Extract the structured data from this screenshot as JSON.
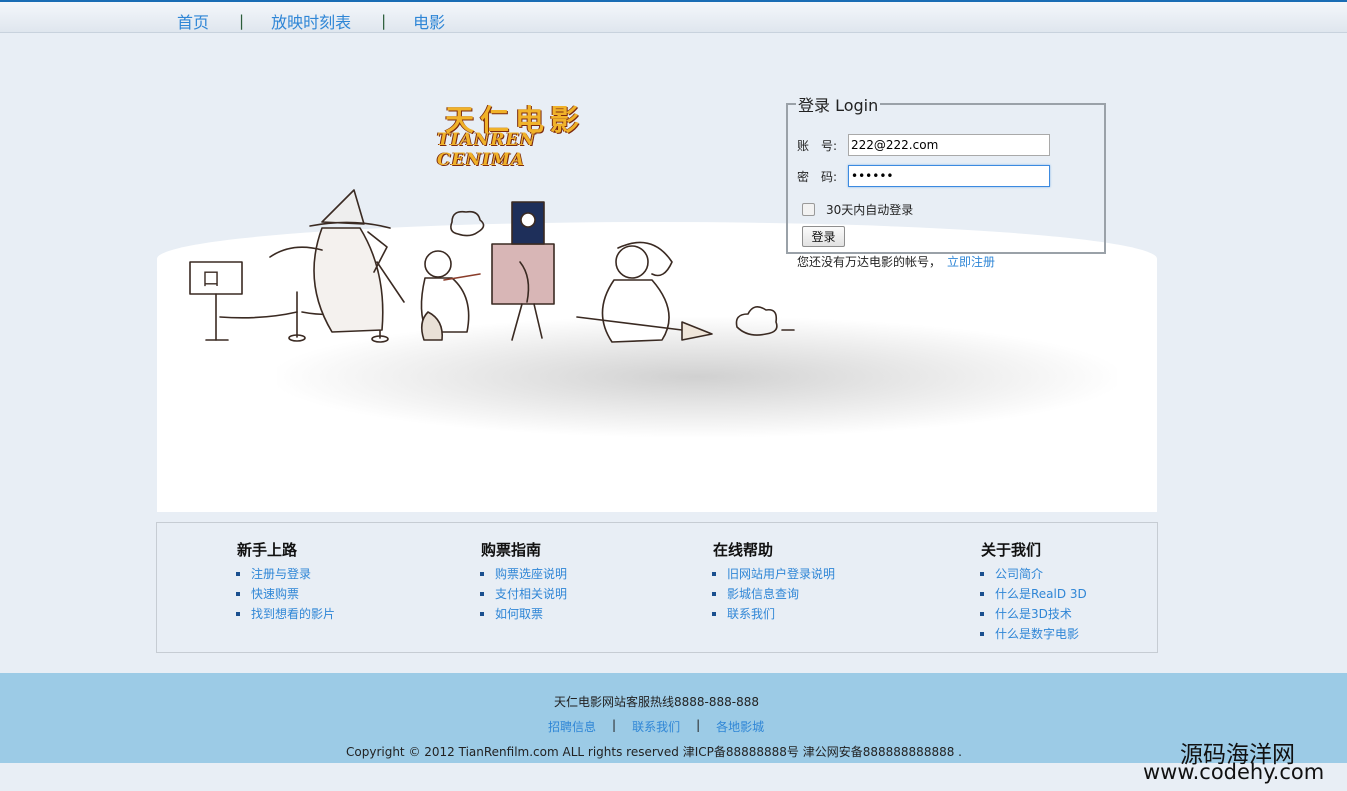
{
  "nav": {
    "items": [
      {
        "label": "首页"
      },
      {
        "label": "放映时刻表"
      },
      {
        "label": "电影"
      }
    ]
  },
  "hero": {
    "logo_cn": "天仁电影",
    "logo_en": "TIANREN CENIMA",
    "sign_text": "口"
  },
  "login": {
    "legend": "登录 Login",
    "account_label": "账　号:",
    "account_value": "222@222.com",
    "password_label": "密　码:",
    "password_value": "••••••",
    "remember_label": "30天内自动登录",
    "submit_label": "登录",
    "no_account_text": "您还没有万达电影的帐号，",
    "register_link": "立即注册"
  },
  "help": {
    "columns": [
      {
        "title": "新手上路",
        "links": [
          "注册与登录",
          "快速购票",
          "找到想看的影片"
        ]
      },
      {
        "title": "购票指南",
        "links": [
          "购票选座说明",
          "支付相关说明",
          "如何取票"
        ]
      },
      {
        "title": "在线帮助",
        "links": [
          "旧网站用户登录说明",
          "影城信息查询",
          "联系我们"
        ]
      },
      {
        "title": "关于我们",
        "links": [
          "公司简介",
          "什么是RealD 3D",
          "什么是3D技术",
          "什么是数字电影"
        ]
      }
    ]
  },
  "footer": {
    "hotline": "天仁电影网站客服热线8888-888-888",
    "links": [
      "招聘信息",
      "联系我们",
      "各地影城"
    ],
    "separator": "|",
    "copyright": "Copyright © 2012 TianRenfilm.com ALL rights reserved 津ICP备88888888号 津公网安备888888888888 ."
  },
  "watermark": {
    "line1": "源码海洋网",
    "line2": "www.codehy.com"
  },
  "colors": {
    "link": "#2f86d6",
    "page_bg": "#e8eef5",
    "footer_bg": "#9ccbe6",
    "topbar_border": "#1a6db5"
  }
}
